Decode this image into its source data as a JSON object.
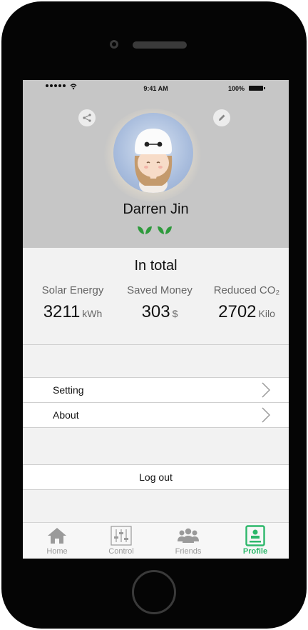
{
  "status_bar": {
    "time": "9:41 AM",
    "battery": "100%"
  },
  "profile": {
    "name": "Darren Jin"
  },
  "totals": {
    "title": "In total",
    "stats": [
      {
        "label": "Solar Energy",
        "value": "3211",
        "unit": "kWh"
      },
      {
        "label": "Saved Money",
        "value": "303",
        "unit": "$"
      },
      {
        "label": "Reduced CO₂",
        "value": "2702",
        "unit": "Kilo"
      }
    ]
  },
  "menu": {
    "items": [
      {
        "label": "Setting"
      },
      {
        "label": "About"
      }
    ]
  },
  "logout": {
    "label": "Log out"
  },
  "tabs": [
    {
      "label": "Home",
      "icon": "home-icon"
    },
    {
      "label": "Control",
      "icon": "sliders-icon"
    },
    {
      "label": "Friends",
      "icon": "people-icon"
    },
    {
      "label": "Profile",
      "icon": "profile-card-icon",
      "active": true
    }
  ],
  "colors": {
    "accent": "#2db86b",
    "header_bg": "#c6c6c6",
    "leaf": "#2e9a3c"
  }
}
